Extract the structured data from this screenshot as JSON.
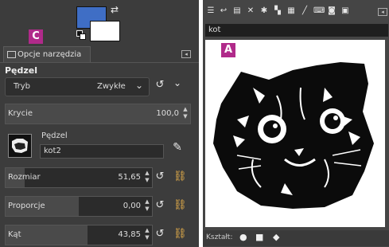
{
  "left": {
    "badge": "C",
    "tab_label": "Opcje narzędzia",
    "tool_header": "Pędzel",
    "mode": {
      "label": "Tryb",
      "value": "Zwykłe"
    },
    "opacity": {
      "label": "Krycie",
      "value": "100,0",
      "fraction": 1.0
    },
    "brush": {
      "label": "Pędzel",
      "name": "kot2"
    },
    "size": {
      "label": "Rozmiar",
      "value": "51,65",
      "fraction": 0.13
    },
    "aspect": {
      "label": "Proporcje",
      "value": "0,00",
      "fraction": 0.5
    },
    "angle": {
      "label": "Kąt",
      "value": "43,85",
      "fraction": 0.56
    }
  },
  "right": {
    "badge": "A",
    "image_name": "kot",
    "shape_label": "Kształt:"
  }
}
